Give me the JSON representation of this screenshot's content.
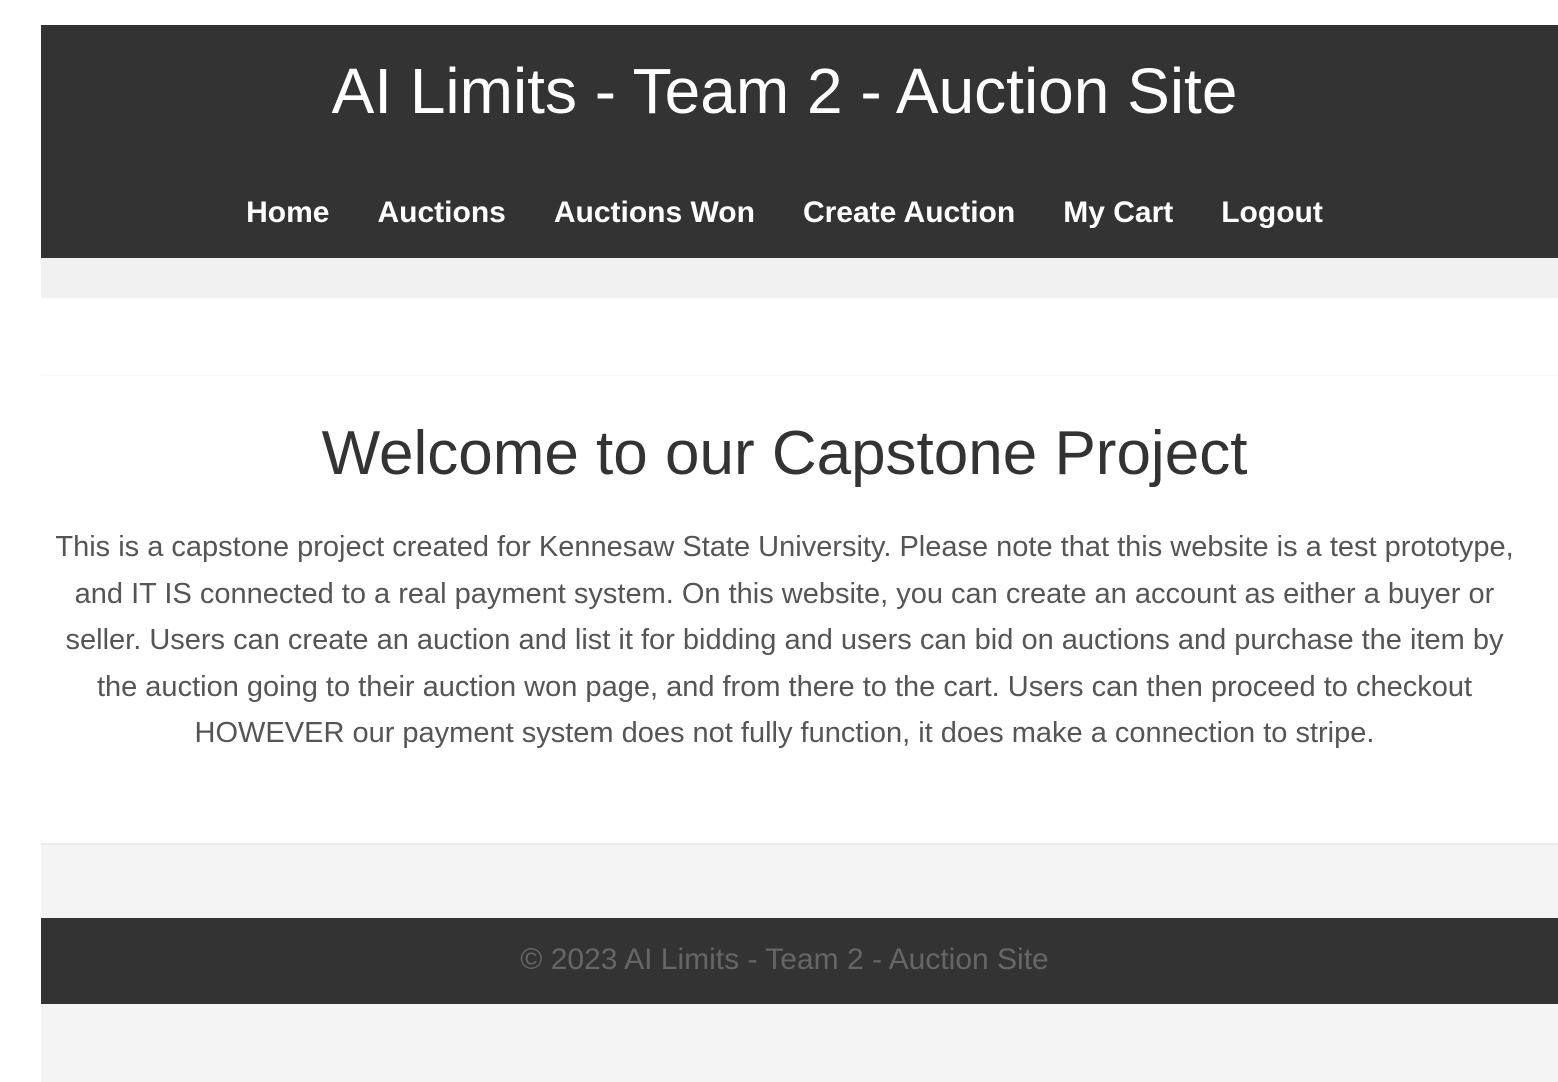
{
  "header": {
    "title": "AI Limits - Team 2 - Auction Site"
  },
  "nav": {
    "items": [
      {
        "label": "Home"
      },
      {
        "label": "Auctions"
      },
      {
        "label": "Auctions Won"
      },
      {
        "label": "Create Auction"
      },
      {
        "label": "My Cart"
      },
      {
        "label": "Logout"
      }
    ]
  },
  "main": {
    "heading": "Welcome to our Capstone Project",
    "description": "This is a capstone project created for Kennesaw State University. Please note that this website is a test prototype, and IT IS connected to a real payment system. On this website, you can create an account as either a buyer or seller. Users can create an auction and list it for bidding and users can bid on auctions and purchase the item by the auction going to their auction won page, and from there to the cart. Users can then proceed to checkout HOWEVER our payment system does not fully function, it does make a connection to stripe."
  },
  "footer": {
    "copyright": "© 2023 AI Limits - Team 2 - Auction Site"
  },
  "colors": {
    "header_bg": "#333333",
    "page_bg": "#f4f4f4",
    "content_bg": "#ffffff",
    "heading_text": "#333333",
    "body_text": "#555555",
    "footer_text": "#666666"
  }
}
